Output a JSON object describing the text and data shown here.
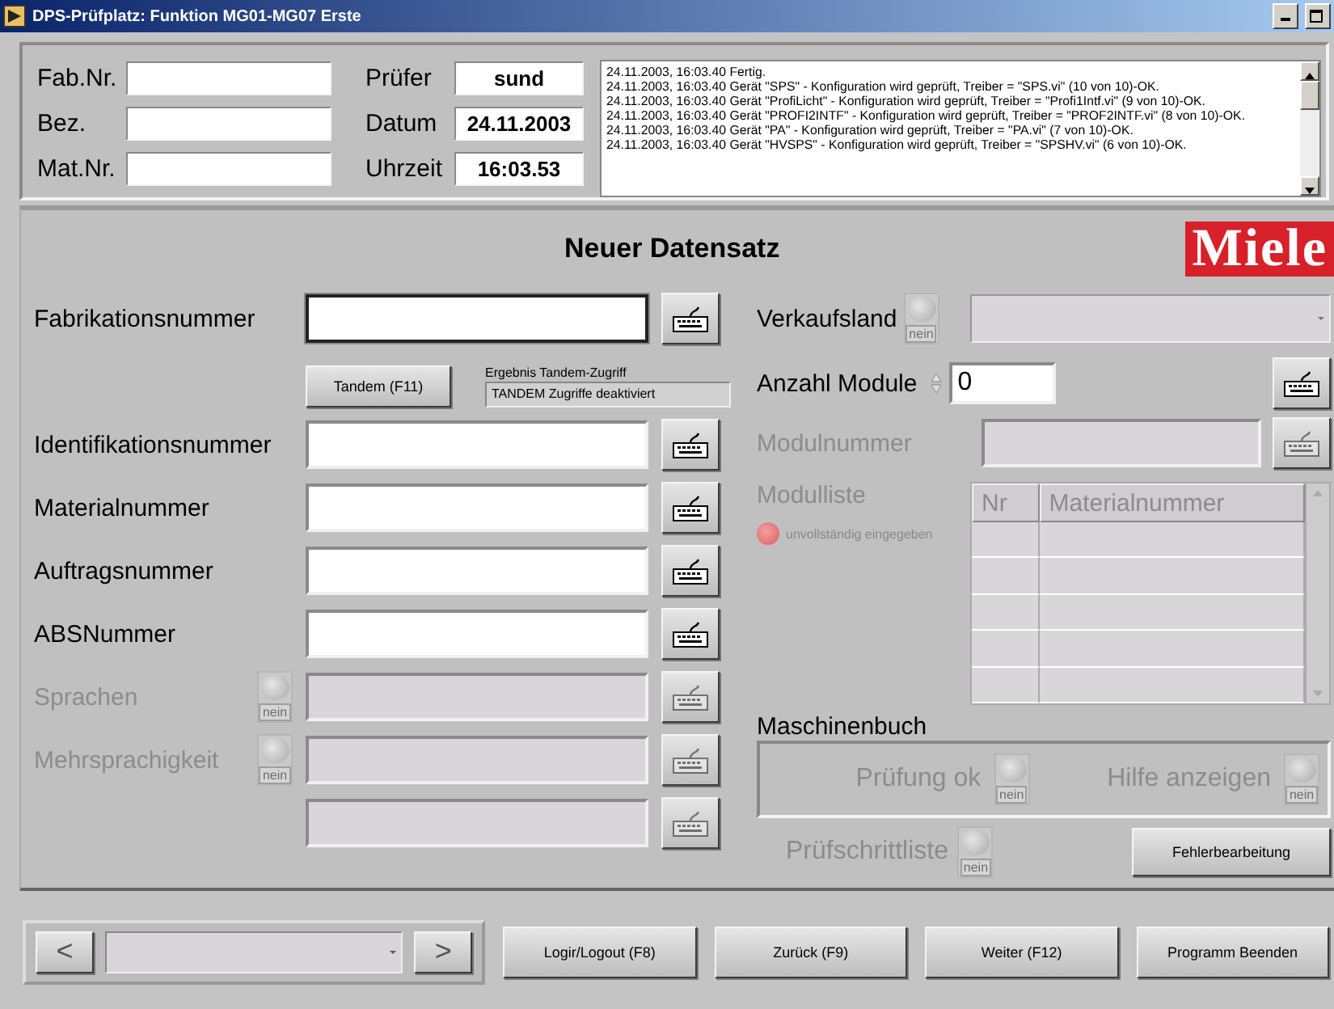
{
  "window": {
    "title": "DPS-Prüfplatz: Funktion MG01-MG07 Erste"
  },
  "header": {
    "fields": [
      {
        "label": "Fab.Nr."
      },
      {
        "label": "Bez."
      },
      {
        "label": "Mat.Nr."
      }
    ],
    "info": [
      {
        "label": "Prüfer",
        "value": "sund"
      },
      {
        "label": "Datum",
        "value": "24.11.2003"
      },
      {
        "label": "Uhrzeit",
        "value": "16:03.53"
      }
    ],
    "log": [
      "24.11.2003, 16:03.40  Fertig.",
      "24.11.2003, 16:03.40  Gerät \"SPS\" -  Konfiguration wird geprüft, Treiber = \"SPS.vi\" (10 von 10)-OK.",
      "24.11.2003, 16:03.40  Gerät \"ProfiLicht\" -  Konfiguration wird geprüft, Treiber = \"Profi1Intf.vi\" (9 von 10)-OK.",
      "24.11.2003, 16:03.40  Gerät \"PROFI2INTF\" -  Konfiguration wird geprüft, Treiber = \"PROF2INTF.vi\" (8 von 10)-OK.",
      "24.11.2003, 16:03.40  Gerät \"PA\" -  Konfiguration wird geprüft, Treiber = \"PA.vi\" (7 von 10)-OK.",
      "24.11.2003, 16:03.40  Gerät \"HVSPS\" -  Konfiguration wird geprüft, Treiber = \"SPSHV.vi\" (6 von 10)-OK."
    ]
  },
  "form": {
    "title": "Neuer Datensatz",
    "logo": "Miele",
    "left_rows": [
      {
        "kind": "field",
        "label": "Fabrikationsnummer",
        "disabled": false,
        "focused": true
      },
      {
        "kind": "tandem",
        "button": "Tandem (F11)",
        "result_label": "Ergebnis Tandem-Zugriff",
        "result": "TANDEM Zugriffe deaktiviert"
      },
      {
        "kind": "field",
        "label": "Identifikationsnummer",
        "disabled": false,
        "focused": false
      },
      {
        "kind": "field",
        "label": "Materialnummer",
        "disabled": false,
        "focused": false
      },
      {
        "kind": "field",
        "label": "Auftragsnummer",
        "disabled": false,
        "focused": false
      },
      {
        "kind": "field",
        "label": "ABSNummer",
        "disabled": false,
        "focused": false
      },
      {
        "kind": "field",
        "label": "Sprachen",
        "toggle": {
          "label": "nein",
          "on": false
        },
        "disabled": true,
        "focused": false
      },
      {
        "kind": "field",
        "label": "Mehrsprachigkeit",
        "toggle": {
          "label": "nein",
          "on": false
        },
        "disabled": true,
        "focused": false
      },
      {
        "kind": "field",
        "disabled": true,
        "focused": false
      }
    ],
    "verkaufsland": {
      "label": "Verkaufsland",
      "toggle": {
        "label": "nein",
        "on": false
      },
      "disabled": true
    },
    "anzahl_module": {
      "label": "Anzahl Module",
      "value": "0"
    },
    "modulnummer": {
      "label": "Modulnummer",
      "disabled": true
    },
    "modulliste": {
      "label": "Modulliste",
      "disabled": true,
      "indicator": {
        "label": "unvollständig eingegeben",
        "on": true
      },
      "columns": [
        "Nr",
        "Materialnummer"
      ]
    },
    "maschinenbuch": {
      "label": "Maschinenbuch",
      "items": [
        {
          "label": "Prüfung ok",
          "toggle": {
            "label": "nein",
            "on": false
          },
          "disabled": true
        },
        {
          "label": "Hilfe anzeigen",
          "toggle": {
            "label": "nein",
            "on": false
          },
          "disabled": true
        }
      ]
    },
    "pruefschrittliste": {
      "label": "Prüfschrittliste",
      "toggle": {
        "label": "nein",
        "on": false
      },
      "disabled": true
    },
    "error_button": "Fehlerbearbeitung"
  },
  "footer": {
    "prev": "<",
    "next": ">",
    "buttons": [
      "Logir/Logout (F8)",
      "Zurück (F9)",
      "Weiter (F12)",
      "Programm Beenden"
    ]
  }
}
